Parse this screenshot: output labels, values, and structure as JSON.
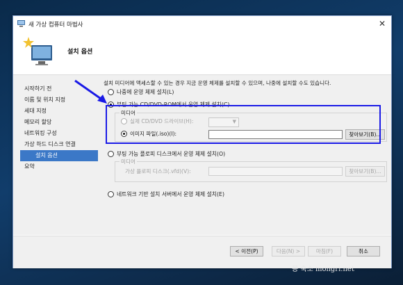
{
  "window": {
    "title": "새 가상 컴퓨터 마법사",
    "close_glyph": "✕"
  },
  "header": {
    "title": "설치 옵션"
  },
  "steps": [
    {
      "label": "시작하기 전"
    },
    {
      "label": "이름 및 위치 지정"
    },
    {
      "label": "세대 지정"
    },
    {
      "label": "메모리 할당"
    },
    {
      "label": "네트워킹 구성"
    },
    {
      "label": "가상 하드 디스크 연결"
    },
    {
      "label": "설치 옵션",
      "active": true
    },
    {
      "label": "요약"
    }
  ],
  "content": {
    "description": "설치 미디어에 액세스할 수 있는 경우 지금 운영 체제를 설치할 수 있으며, 나중에 설치할 수도 있습니다.",
    "options": {
      "later": "나중에 운영 체제 설치(L)",
      "cd": "부팅 가능 CD/DVD-ROM에서 운영 체제 설치(C)",
      "floppy": "부팅 가능 플로피 디스크에서 운영 체제 설치(O)",
      "network": "네트워크 기반 설치 서버에서 운영 체제 설치(E)"
    },
    "cd_media": {
      "legend": "미디어",
      "physical_label": "실제 CD/DVD 드라이브(H):",
      "physical_value": "",
      "image_label": "이미지 파일(.iso)(I):",
      "image_value": "",
      "browse_label": "찾아보기(B)..."
    },
    "floppy_media": {
      "legend": "미디어",
      "virtual_label": "가상 플로피 디스크(.vfd)(V):",
      "virtual_value": "",
      "browse_label": "찾아보기(B)..."
    }
  },
  "footer": {
    "prev": "< 이전(P)",
    "next": "다음(N) >",
    "finish": "마침(F)",
    "cancel": "취소"
  },
  "watermark": "몽 숙소 mongri.net",
  "colors": {
    "highlight": "#1a1ae6",
    "active_step": "#3b78c7"
  }
}
